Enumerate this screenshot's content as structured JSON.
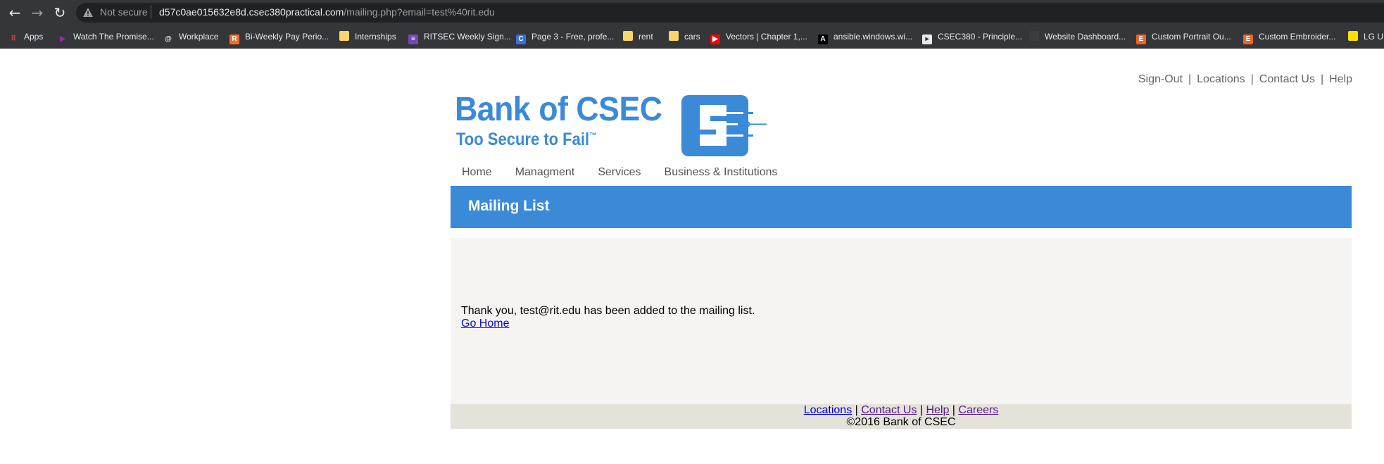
{
  "browser": {
    "security_label": "Not secure",
    "url_host": "d57c0ae015632e8d.csec380practical.com",
    "url_path": "/mailing.php?email=test%40rit.edu",
    "bookmarks": [
      {
        "label": "Apps",
        "icon": "apps-grid-icon"
      },
      {
        "label": "Watch The Promise...",
        "icon": "play-icon"
      },
      {
        "label": "Workplace",
        "icon": "at-icon"
      },
      {
        "label": "Bi-Weekly Pay Perio...",
        "icon": "rit-icon"
      },
      {
        "label": "Internships",
        "icon": "folder-icon"
      },
      {
        "label": "RITSEC Weekly Sign...",
        "icon": "form-icon"
      },
      {
        "label": "Page 3 - Free, profe...",
        "icon": "c-icon"
      },
      {
        "label": "rent",
        "icon": "folder-icon"
      },
      {
        "label": "cars",
        "icon": "folder-icon"
      },
      {
        "label": "Vectors | Chapter 1,...",
        "icon": "youtube-icon"
      },
      {
        "label": "ansible.windows.wi...",
        "icon": "ansible-icon"
      },
      {
        "label": "CSEC380 - Principle...",
        "icon": "slides-icon"
      },
      {
        "label": "Website Dashboard...",
        "icon": "blank-icon"
      },
      {
        "label": "Custom Portrait Ou...",
        "icon": "etsy-icon"
      },
      {
        "label": "Custom Embroider...",
        "icon": "etsy-icon"
      },
      {
        "label": "LG U",
        "icon": "tag-icon"
      }
    ]
  },
  "top_links": [
    "Sign-Out",
    "Locations",
    "Contact Us",
    "Help"
  ],
  "logo": {
    "name": "Bank of CSEC",
    "tagline": "Too Secure to Fail",
    "trademark": "™"
  },
  "nav": [
    "Home",
    "Managment",
    "Services",
    "Business & Institutions"
  ],
  "page_title": "Mailing List",
  "content": {
    "message": "Thank you, test@rit.edu has been added to the mailing list.",
    "go_home": "Go Home"
  },
  "footer": {
    "links": [
      "Locations",
      "Contact Us",
      "Help",
      "Careers"
    ],
    "copyright": "©2016 Bank of CSEC"
  },
  "colors": {
    "brand_blue": "#3a8ad8",
    "content_bg": "#f5f4f2",
    "footer_bg": "#e5e2da"
  }
}
